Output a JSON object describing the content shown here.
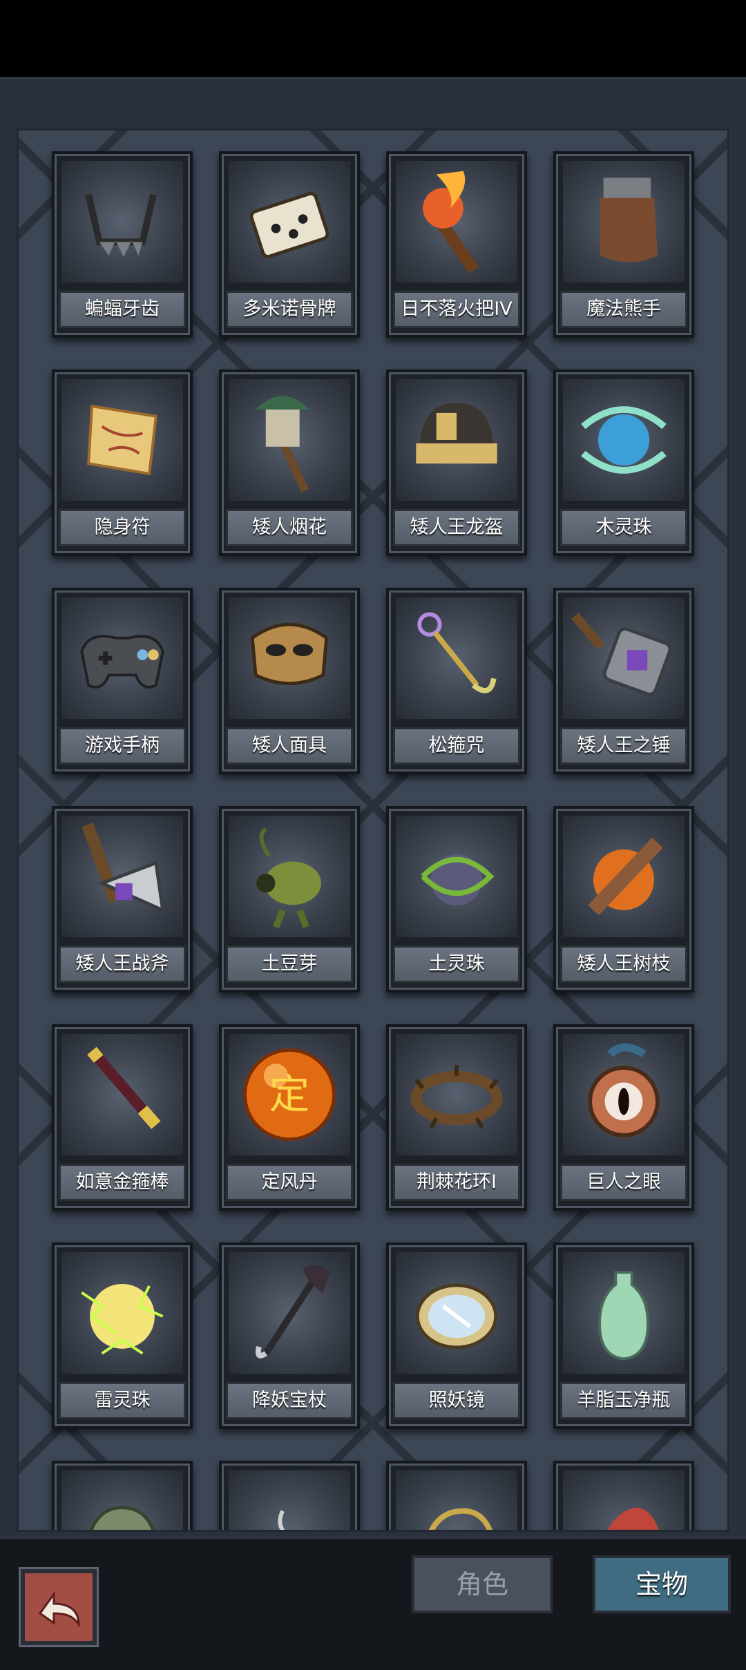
{
  "items": [
    {
      "name": "蝙蝠牙齿",
      "icon": "bat-fang-icon"
    },
    {
      "name": "多米诺骨牌",
      "icon": "domino-icon"
    },
    {
      "name": "日不落火把IV",
      "icon": "torch-icon"
    },
    {
      "name": "魔法熊手",
      "icon": "bear-paw-icon"
    },
    {
      "name": "隐身符",
      "icon": "invisibility-talisman-icon"
    },
    {
      "name": "矮人烟花",
      "icon": "firework-icon"
    },
    {
      "name": "矮人王龙盔",
      "icon": "helmet-icon"
    },
    {
      "name": "木灵珠",
      "icon": "wood-orb-icon"
    },
    {
      "name": "游戏手柄",
      "icon": "gamepad-icon"
    },
    {
      "name": "矮人面具",
      "icon": "mask-icon"
    },
    {
      "name": "松箍咒",
      "icon": "spell-wand-icon"
    },
    {
      "name": "矮人王之锤",
      "icon": "hammer-icon"
    },
    {
      "name": "矮人王战斧",
      "icon": "battle-axe-icon"
    },
    {
      "name": "土豆芽",
      "icon": "potato-sprout-icon"
    },
    {
      "name": "土灵珠",
      "icon": "earth-orb-icon"
    },
    {
      "name": "矮人王树枝",
      "icon": "branch-icon"
    },
    {
      "name": "如意金箍棒",
      "icon": "golden-staff-icon"
    },
    {
      "name": "定风丹",
      "icon": "wind-pill-icon",
      "glyph": "定"
    },
    {
      "name": "荆棘花环I",
      "icon": "thorn-wreath-icon"
    },
    {
      "name": "巨人之眼",
      "icon": "giant-eye-icon"
    },
    {
      "name": "雷灵珠",
      "icon": "thunder-orb-icon"
    },
    {
      "name": "降妖宝杖",
      "icon": "demon-staff-icon"
    },
    {
      "name": "照妖镜",
      "icon": "mirror-icon"
    },
    {
      "name": "羊脂玉净瓶",
      "icon": "jade-vase-icon"
    },
    {
      "name": "",
      "icon": "green-helmet-icon"
    },
    {
      "name": "",
      "icon": "teacup-icon"
    },
    {
      "name": "",
      "icon": "rope-icon"
    },
    {
      "name": "",
      "icon": "jester-hat-icon"
    }
  ],
  "tabs": {
    "role": "角色",
    "treasure": "宝物"
  },
  "colors": {
    "active_tab": "#3f6c80",
    "back_button": "#a24e45",
    "panel": "#3c4655"
  }
}
